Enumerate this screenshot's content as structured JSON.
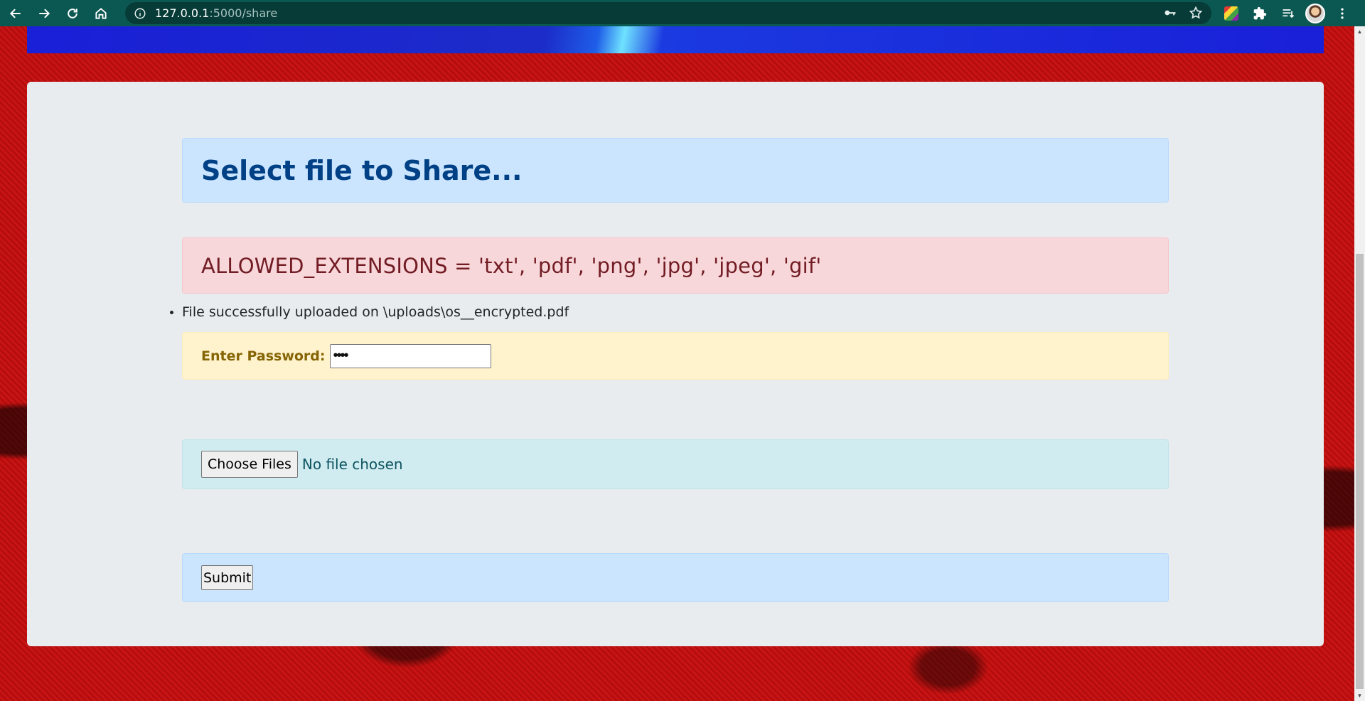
{
  "browser": {
    "url_host": "127.0.0.1",
    "url_rest": ":5000/share",
    "icons": [
      "back-icon",
      "forward-icon",
      "reload-icon",
      "home-icon",
      "site-info-icon",
      "key-icon",
      "star-icon",
      "extension-icon",
      "puzzle-icon",
      "reading-list-icon",
      "menu-icon"
    ]
  },
  "page": {
    "title": "Select file to Share...",
    "allowed_extensions": "ALLOWED_EXTENSIONS = 'txt', 'pdf', 'png', 'jpg', 'jpeg', 'gif'",
    "messages": [
      "File successfully uploaded on \\uploads\\os__encrypted.pdf"
    ],
    "password_label": "Enter Password:",
    "password_value": "••••",
    "choose_files_label": "Choose Files",
    "file_status": "No file chosen",
    "submit_label": "Submit"
  },
  "colors": {
    "chrome": "#0b5852",
    "title_alert": "#cce5ff",
    "extensions_alert": "#f8d7da",
    "password_alert": "#fff3cd",
    "file_alert": "#d1ecf1",
    "submit_alert": "#cce5ff"
  }
}
